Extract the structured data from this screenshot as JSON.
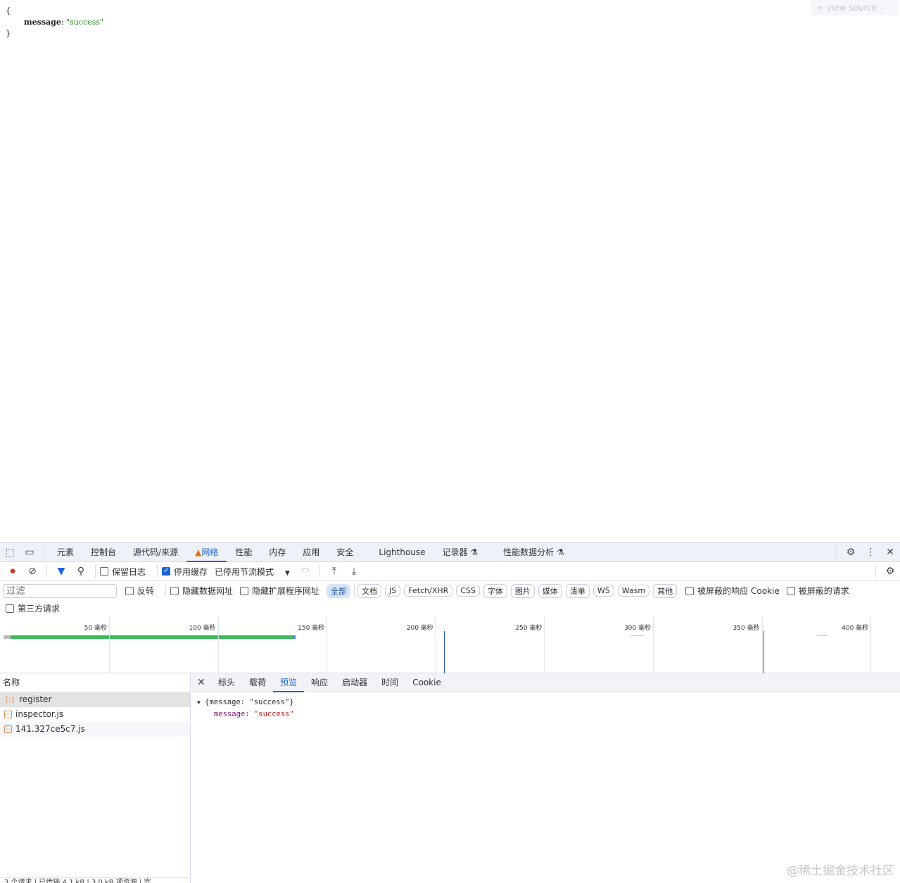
{
  "page": {
    "open_brace": "{",
    "close_brace": "}",
    "key": "message",
    "value": "\"success\"",
    "view_source": "+  view source  -"
  },
  "devtools": {
    "tabs": [
      "元素",
      "控制台",
      "源代码/来源",
      "网络",
      "性能",
      "内存",
      "应用",
      "安全",
      "Lighthouse",
      "记录器",
      "性能数据分析"
    ],
    "active_tab": "网络",
    "toolbar": {
      "preserve_log": "保留日志",
      "disable_cache": "停用缓存",
      "throttle": "已停用节流模式"
    },
    "filter": {
      "placeholder": "过滤",
      "invert": "反转",
      "hide_data_urls": "隐藏数据网址",
      "hide_ext_urls": "隐藏扩展程序网址",
      "types": [
        "全部",
        "文档",
        "JS",
        "Fetch/XHR",
        "CSS",
        "字体",
        "图片",
        "媒体",
        "清单",
        "WS",
        "Wasm",
        "其他"
      ],
      "blocked_cookies": "被屏蔽的响应 Cookie",
      "blocked_requests": "被屏蔽的请求",
      "third_party": "第三方请求"
    },
    "timeline": {
      "ticks": [
        "50 毫秒",
        "100 毫秒",
        "150 毫秒",
        "200 毫秒",
        "250 毫秒",
        "300 毫秒",
        "350 毫秒",
        "400 毫秒"
      ],
      "dom_content_loaded_color": "#1a4fa8",
      "load_color": "#c0392b"
    },
    "requests": {
      "header": "名称",
      "items": [
        "register",
        "inspector.js",
        "141.327ce5c7.js"
      ]
    },
    "detail": {
      "tabs": [
        "标头",
        "载荷",
        "预览",
        "响应",
        "启动器",
        "时间",
        "Cookie"
      ],
      "active": "预览",
      "summary": "{message: \"success\"}",
      "key": "message",
      "value": "\"success\""
    },
    "status": "3 个请求 | 已传输 4.1 kB | 3.0 kB 项资源 | 完"
  },
  "watermark": "@稀土掘金技术社区"
}
